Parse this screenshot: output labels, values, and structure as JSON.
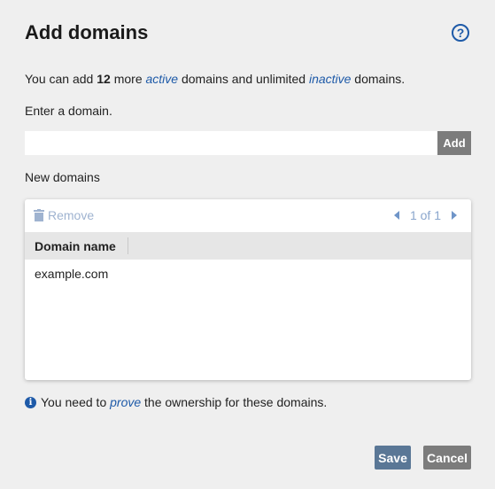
{
  "dialog": {
    "title": "Add domains",
    "help_icon": "question-circle-icon",
    "info": {
      "part1": "You can add ",
      "count": "12",
      "part2": " more ",
      "active": "active",
      "part3": " domains and unlimited ",
      "inactive": "inactive",
      "part4": " domains."
    },
    "enter_label": "Enter a domain.",
    "input": {
      "value": "",
      "placeholder": ""
    },
    "add_label": "Add",
    "new_domains_label": "New domains",
    "toolbar": {
      "remove_label": "Remove",
      "remove_icon": "trash-icon",
      "pager_text": "1 of 1"
    },
    "table": {
      "columns": [
        "Domain name"
      ],
      "rows": [
        [
          "example.com"
        ]
      ]
    },
    "note": {
      "icon": "info-icon",
      "part1": "You need to ",
      "link": "prove",
      "part2": " the ownership for these domains."
    },
    "save_label": "Save",
    "cancel_label": "Cancel"
  },
  "colors": {
    "accent": "#1e5aa8",
    "save_button": "#5a7796",
    "cancel_button": "#7c7c7c",
    "background": "#efefef"
  }
}
